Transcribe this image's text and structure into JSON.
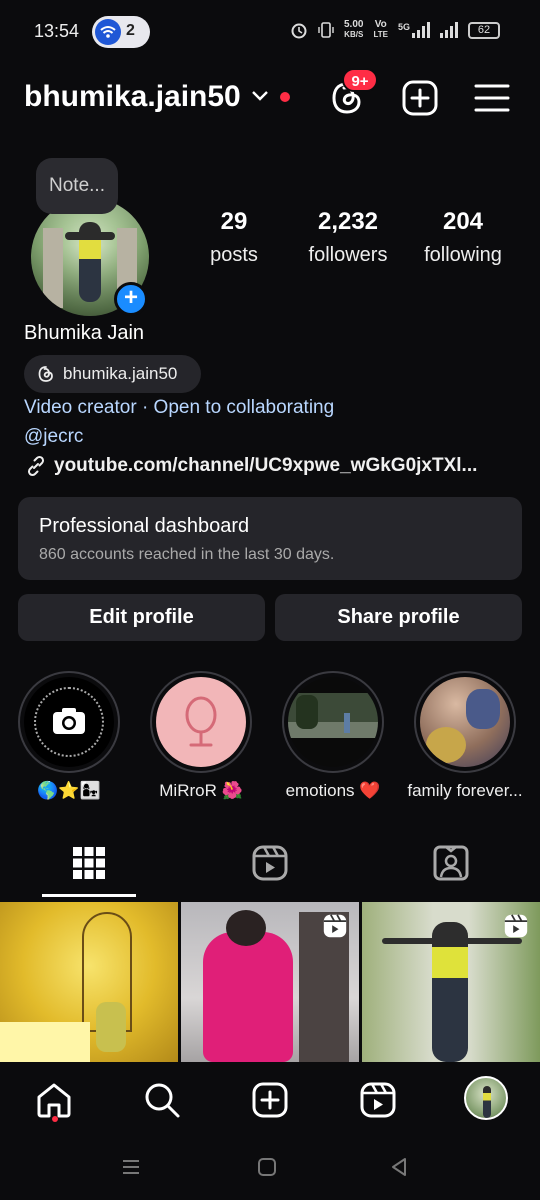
{
  "status_bar": {
    "time": "13:54",
    "wifi_count": "2",
    "speed_top": "5.00",
    "speed_bottom": "KB/S",
    "volte_top": "Vo",
    "volte_bottom": "LTE",
    "network": "5G",
    "battery": "62"
  },
  "header": {
    "username": "bhumika.jain50",
    "threads_badge": "9+",
    "icons": [
      "threads-icon",
      "create-plus-icon",
      "hamburger-menu-icon"
    ]
  },
  "profile": {
    "note_label": "Note...",
    "stats": [
      {
        "value": "29",
        "label": "posts"
      },
      {
        "value": "2,232",
        "label": "followers"
      },
      {
        "value": "204",
        "label": "following"
      }
    ],
    "full_name": "Bhumika Jain",
    "threads_handle": "bhumika.jain50",
    "bio": "Video creator · Open to collaborating",
    "mention": "@jecrc",
    "link": "youtube.com/channel/UC9xpwe_wGkG0jxTXl..."
  },
  "dashboard": {
    "title": "Professional dashboard",
    "subtitle": "860 accounts reached in the last 30 days."
  },
  "actions": {
    "edit_profile": "Edit profile",
    "share_profile": "Share profile"
  },
  "highlights": [
    {
      "label": "🌎⭐👩‍👧"
    },
    {
      "label": "MiRroR 🌺"
    },
    {
      "label": "emotions ❤️"
    },
    {
      "label": "family forever..."
    }
  ],
  "tabs": [
    "grid-icon",
    "reels-icon",
    "tagged-icon"
  ],
  "bottom_nav": [
    "home-icon",
    "search-icon",
    "create-icon",
    "reels-icon",
    "profile-avatar"
  ],
  "colors": {
    "accent_blue": "#1a8cff",
    "notification_red": "#ff2d45",
    "link_blue": "#b9d7ff",
    "card_bg": "#25252a"
  }
}
